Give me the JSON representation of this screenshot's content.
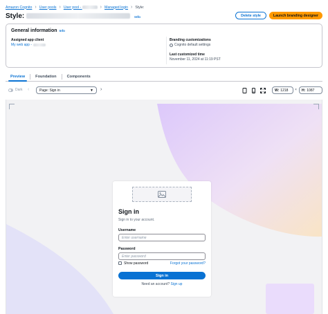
{
  "breadcrumb": {
    "items": [
      "Amazon Cognito",
      "User pools",
      "User pool - ",
      "Managed login",
      "Style:"
    ]
  },
  "header": {
    "title": "Style:",
    "info": "Info",
    "delete_label": "Delete style",
    "launch_label": "Launch branding designer"
  },
  "general": {
    "title": "General information",
    "info": "Info",
    "assigned_label": "Assigned app client",
    "assigned_value": "My web app - ",
    "branding_label": "Branding customizations",
    "branding_value": "Cognito default settings",
    "last_label": "Last customized time",
    "last_value": "November 11, 2024 at 11:19 PST"
  },
  "tabs": [
    {
      "label": "Preview",
      "active": true
    },
    {
      "label": "Foundation",
      "active": false
    },
    {
      "label": "Components",
      "active": false
    }
  ],
  "toolbar": {
    "dark_label": "Dark",
    "page_select": "Page: Sign in",
    "width_label": "W:",
    "width_value": "1218",
    "height_label": "H:",
    "height_value": "1087",
    "times": "×"
  },
  "signin": {
    "title": "Sign in",
    "subtitle": "Sign in to your account.",
    "username_label": "Username",
    "username_placeholder": "Enter username",
    "password_label": "Password",
    "password_placeholder": "Enter password",
    "show_password": "Show password",
    "forgot": "Forgot your password?",
    "button": "Sign in",
    "need_account": "Need an account?",
    "signup": "Sign up"
  },
  "colors": {
    "accent": "#0972d3",
    "primary_button": "#ff9900",
    "canvas_bg": "#f2f2f4"
  }
}
